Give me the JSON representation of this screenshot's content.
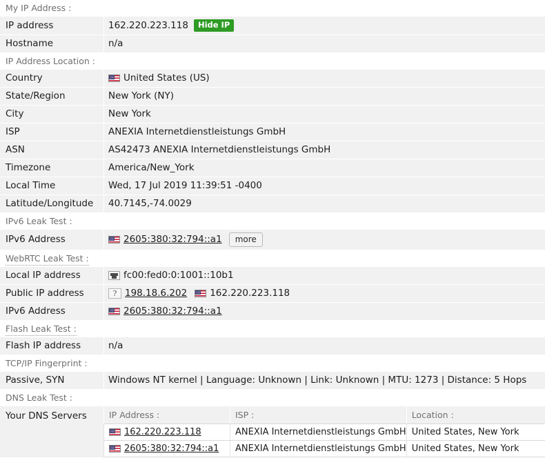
{
  "sections": {
    "my_ip": "My IP Address :",
    "ip_location": "IP Address Location :",
    "ipv6_leak": "IPv6 Leak Test :",
    "webrtc_leak": "WebRTC Leak Test :",
    "flash_leak": "Flash Leak Test :",
    "tcpip_fingerprint": "TCP/IP Fingerprint :",
    "dns_leak": "DNS Leak Test :"
  },
  "my_ip": {
    "ip_label": "IP address",
    "ip_value": "162.220.223.118",
    "hide_ip_label": "Hide IP",
    "hostname_label": "Hostname",
    "hostname_value": "n/a"
  },
  "location": {
    "country_label": "Country",
    "country_value": "United States (US)",
    "state_label": "State/Region",
    "state_value": "New York (NY)",
    "city_label": "City",
    "city_value": "New York",
    "isp_label": "ISP",
    "isp_value": "ANEXIA Internetdienstleistungs GmbH",
    "asn_label": "ASN",
    "asn_value": "AS42473 ANEXIA Internetdienstleistungs GmbH",
    "timezone_label": "Timezone",
    "timezone_value": "America/New_York",
    "localtime_label": "Local Time",
    "localtime_value": "Wed, 17 Jul 2019 11:39:51 -0400",
    "latlon_label": "Latitude/Longitude",
    "latlon_value": "40.7145,-74.0029"
  },
  "ipv6_leak": {
    "label": "IPv6 Address",
    "value": "2605:380:32:794::a1",
    "more_label": "more"
  },
  "webrtc": {
    "local_label": "Local IP address",
    "local_value": "fc00:fed0:0:1001::10b1",
    "public_label": "Public IP address",
    "public_value_1": "198.18.6.202",
    "public_value_2": "162.220.223.118",
    "unknown_glyph": "?",
    "ipv6_label": "IPv6 Address",
    "ipv6_value": "2605:380:32:794::a1"
  },
  "flash": {
    "label": "Flash IP address",
    "value": "n/a"
  },
  "tcpip": {
    "label": "Passive, SYN",
    "value": "Windows NT kernel | Language: Unknown | Link: Unknown | MTU: 1273 | Distance: 5 Hops"
  },
  "dns": {
    "row_label": "Your DNS Servers",
    "headers": {
      "ip": "IP Address :",
      "isp": "ISP :",
      "location": "Location :"
    },
    "rows": [
      {
        "ip": "162.220.223.118",
        "isp": "ANEXIA Internetdienstleistungs GmbH",
        "location": "United States, New York"
      },
      {
        "ip": "2605:380:32:794::a1",
        "isp": "ANEXIA Internetdienstleistungs GmbH",
        "location": "United States, New York"
      }
    ]
  },
  "colors": {
    "row_bg": "#f1f1f1",
    "section_text": "#6f6f6f",
    "hide_ip_green": "#2e9b24",
    "flag_blue": "#3c3b6e",
    "flag_red": "#c8102e"
  }
}
